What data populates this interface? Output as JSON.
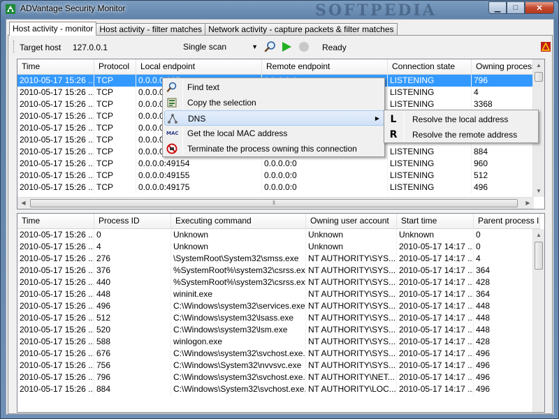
{
  "window": {
    "title": "ADVantage Security Monitor",
    "watermark": "SOFTPEDIA",
    "minimize": "▁",
    "maximize": "□",
    "close": "✕"
  },
  "tabs": [
    {
      "label": "Host activity - monitor",
      "active": true
    },
    {
      "label": "Host activity - filter matches",
      "active": false
    },
    {
      "label": "Network activity - capture packets & filter matches",
      "active": false
    }
  ],
  "toolbar": {
    "target_label": "Target host",
    "target_value": "127.0.0.1",
    "scan_mode": "Single scan",
    "status": "Ready"
  },
  "connections": {
    "columns": [
      "Time",
      "Protocol",
      "Local endpoint",
      "Remote endpoint",
      "Connection state",
      "Owning process ID"
    ],
    "rows": [
      [
        "2010-05-17 15:26 ...",
        "TCP",
        "0.0.0.0:135",
        "0.0.0.0:0",
        "LISTENING",
        "796"
      ],
      [
        "2010-05-17 15:26 ...",
        "TCP",
        "0.0.0.0:4",
        "",
        "LISTENING",
        "4"
      ],
      [
        "2010-05-17 15:26 ...",
        "TCP",
        "0.0.0.0:3",
        "",
        "LISTENING",
        "3368"
      ],
      [
        "2010-05-17 15:26 ...",
        "TCP",
        "0.0.0.0:3",
        "",
        "",
        ""
      ],
      [
        "2010-05-17 15:26 ...",
        "TCP",
        "0.0.0.0:5",
        "",
        "",
        ""
      ],
      [
        "2010-05-17 15:26 ...",
        "TCP",
        "0.0.0.0:4",
        "",
        "",
        ""
      ],
      [
        "2010-05-17 15:26 ...",
        "TCP",
        "0.0.0.0:4",
        "",
        "LISTENING",
        "884"
      ],
      [
        "2010-05-17 15:26 ...",
        "TCP",
        "0.0.0.0:49154",
        "0.0.0.0:0",
        "LISTENING",
        "960"
      ],
      [
        "2010-05-17 15:26 ...",
        "TCP",
        "0.0.0.0:49155",
        "0.0.0.0:0",
        "LISTENING",
        "512"
      ],
      [
        "2010-05-17 15:26 ...",
        "TCP",
        "0.0.0.0:49175",
        "0.0.0.0:0",
        "LISTENING",
        "496"
      ]
    ]
  },
  "processes": {
    "columns": [
      "Time",
      "Process ID",
      "Executing command",
      "Owning user account",
      "Start time",
      "Parent process ID"
    ],
    "rows": [
      [
        "2010-05-17 15:26 ...",
        "0",
        "Unknown",
        "Unknown",
        "Unknown",
        "0"
      ],
      [
        "2010-05-17 15:26 ...",
        "4",
        "Unknown",
        "Unknown",
        "2010-05-17 14:17 ...",
        "0"
      ],
      [
        "2010-05-17 15:26 ...",
        "276",
        "\\SystemRoot\\System32\\smss.exe",
        "NT AUTHORITY\\SYS...",
        "2010-05-17 14:17 ...",
        "4"
      ],
      [
        "2010-05-17 15:26 ...",
        "376",
        "%SystemRoot%\\system32\\csrss.exe...",
        "NT AUTHORITY\\SYS...",
        "2010-05-17 14:17 ...",
        "364"
      ],
      [
        "2010-05-17 15:26 ...",
        "440",
        "%SystemRoot%\\system32\\csrss.exe...",
        "NT AUTHORITY\\SYS...",
        "2010-05-17 14:17 ...",
        "428"
      ],
      [
        "2010-05-17 15:26 ...",
        "448",
        "wininit.exe",
        "NT AUTHORITY\\SYS...",
        "2010-05-17 14:17 ...",
        "364"
      ],
      [
        "2010-05-17 15:26 ...",
        "496",
        "C:\\Windows\\system32\\services.exe",
        "NT AUTHORITY\\SYS...",
        "2010-05-17 14:17 ...",
        "448"
      ],
      [
        "2010-05-17 15:26 ...",
        "512",
        "C:\\Windows\\system32\\lsass.exe",
        "NT AUTHORITY\\SYS...",
        "2010-05-17 14:17 ...",
        "448"
      ],
      [
        "2010-05-17 15:26 ...",
        "520",
        "C:\\Windows\\system32\\lsm.exe",
        "NT AUTHORITY\\SYS...",
        "2010-05-17 14:17 ...",
        "448"
      ],
      [
        "2010-05-17 15:26 ...",
        "588",
        "winlogon.exe",
        "NT AUTHORITY\\SYS...",
        "2010-05-17 14:17 ...",
        "428"
      ],
      [
        "2010-05-17 15:26 ...",
        "676",
        "C:\\Windows\\system32\\svchost.exe...",
        "NT AUTHORITY\\SYS...",
        "2010-05-17 14:17 ...",
        "496"
      ],
      [
        "2010-05-17 15:26 ...",
        "756",
        "C:\\Windows\\System32\\nvvsvc.exe",
        "NT AUTHORITY\\SYS...",
        "2010-05-17 14:17 ...",
        "496"
      ],
      [
        "2010-05-17 15:26 ...",
        "796",
        "C:\\Windows\\system32\\svchost.exe...",
        "NT AUTHORITY\\NET...",
        "2010-05-17 14:17 ...",
        "496"
      ],
      [
        "2010-05-17 15:26 ...",
        "884",
        "C:\\Windows\\System32\\svchost.exe...",
        "NT AUTHORITY\\LOC...",
        "2010-05-17 14:17 ...",
        "496"
      ]
    ]
  },
  "context_menu": {
    "items": [
      {
        "label": "Find text",
        "icon": "magnifier-icon"
      },
      {
        "label": "Copy the selection",
        "icon": "copy-icon"
      },
      {
        "label": "DNS",
        "icon": "dns-icon",
        "submenu": true
      },
      {
        "label": "Get the local MAC address",
        "icon": "mac-icon",
        "icon_text": "MAC"
      },
      {
        "label": "Terminate the process owning this connection",
        "icon": "terminate-icon"
      }
    ],
    "dns_submenu": [
      {
        "label": "Resolve the local address",
        "icon_letter": "L"
      },
      {
        "label": "Resolve the remote address",
        "icon_letter": "R"
      }
    ]
  },
  "colors": {
    "selection": "#3399ff",
    "play_green": "#22b022"
  }
}
